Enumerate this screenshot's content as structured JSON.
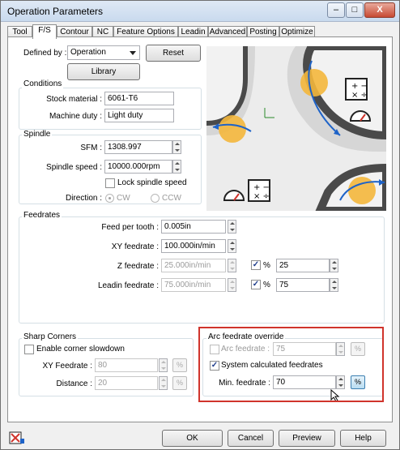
{
  "window": {
    "title": "Operation Parameters",
    "min_label": "–",
    "max_label": "□",
    "close_label": "X"
  },
  "tabs": [
    "Tool",
    "F/S",
    "Contour",
    "NC",
    "Feature Options",
    "Leadin",
    "Advanced",
    "Posting",
    "Optimize"
  ],
  "defined_by": {
    "label": "Defined by :",
    "value": "Operation",
    "reset_label": "Reset",
    "library_label": "Library"
  },
  "conditions": {
    "title": "Conditions",
    "stock_label": "Stock material :",
    "stock_value": "6061-T6",
    "duty_label": "Machine duty :",
    "duty_value": "Light duty"
  },
  "spindle": {
    "title": "Spindle",
    "sfm_label": "SFM :",
    "sfm_value": "1308.997",
    "speed_label": "Spindle speed :",
    "speed_value": "10000.000rpm",
    "lock_label": "Lock spindle speed",
    "direction_label": "Direction :",
    "cw_label": "CW",
    "ccw_label": "CCW"
  },
  "feedrates": {
    "title": "Feedrates",
    "per_tooth_label": "Feed per tooth :",
    "per_tooth_value": "0.005in",
    "xy_label": "XY feedrate :",
    "xy_value": "100.000in/min",
    "z_label": "Z feedrate :",
    "z_value": "25.000in/min",
    "z_pct_label": "%",
    "z_pct_value": "25",
    "leadin_label": "Leadin feedrate :",
    "leadin_value": "75.000in/min",
    "leadin_pct_label": "%",
    "leadin_pct_value": "75"
  },
  "sharp_corners": {
    "title": "Sharp Corners",
    "enable_label": "Enable corner slowdown",
    "xy_label": "XY Feedrate :",
    "xy_value": "80",
    "distance_label": "Distance :",
    "distance_value": "20",
    "pct_label": "%"
  },
  "arc_override": {
    "title": "Arc feedrate override",
    "arc_label": "Arc feedrate :",
    "arc_value": "75",
    "system_label": "System calculated feedrates",
    "min_label": "Min. feedrate :",
    "min_value": "70",
    "pct_label": "%"
  },
  "buttons": {
    "ok": "OK",
    "cancel": "Cancel",
    "preview": "Preview",
    "help": "Help"
  },
  "colors": {
    "accent": "#d0342c",
    "arrow_blue": "#1e63c8",
    "orange": "#f4b73c"
  }
}
